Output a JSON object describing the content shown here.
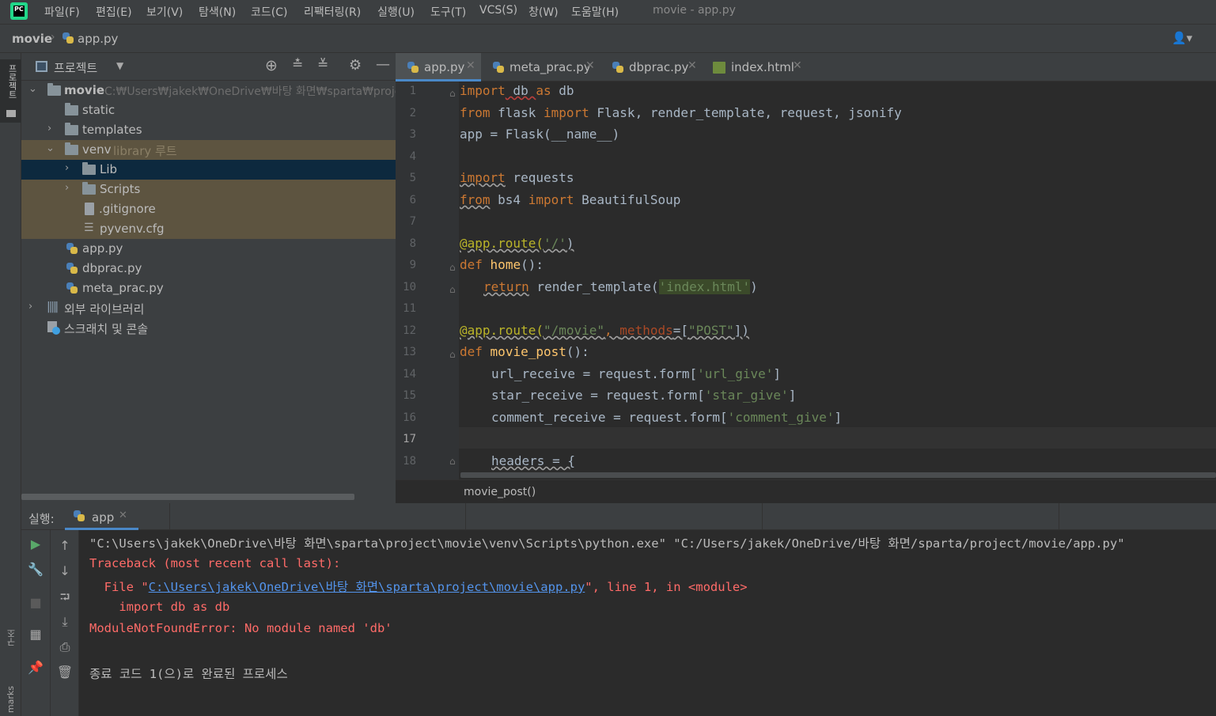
{
  "menubar": {
    "items": [
      "파일(F)",
      "편집(E)",
      "보기(V)",
      "탐색(N)",
      "코드(C)",
      "리팩터링(R)",
      "실행(U)",
      "도구(T)",
      "VCS(S)",
      "창(W)",
      "도움말(H)"
    ],
    "window_title": "movie - app.py"
  },
  "navbar": {
    "project": "movie",
    "file": "app.py"
  },
  "side_stripe": {
    "project_label": "프로젝트",
    "structure_label": "구조",
    "bookmarks_label": "marks"
  },
  "project_panel": {
    "title": "프로젝트",
    "tree": [
      {
        "label": "movie",
        "hint": "C:₩Users₩jakek₩OneDrive₩바탕 화면₩sparta₩project"
      },
      {
        "label": "static"
      },
      {
        "label": "templates"
      },
      {
        "label": "venv",
        "hint": "library 루트"
      },
      {
        "label": "Lib"
      },
      {
        "label": "Scripts"
      },
      {
        "label": ".gitignore"
      },
      {
        "label": "pyvenv.cfg"
      },
      {
        "label": "app.py"
      },
      {
        "label": "dbprac.py"
      },
      {
        "label": "meta_prac.py"
      },
      {
        "label": "외부 라이브러리"
      },
      {
        "label": "스크래치 및 콘솔"
      }
    ]
  },
  "editor": {
    "tabs": [
      "app.py",
      "meta_prac.py",
      "dbprac.py",
      "index.html"
    ],
    "active_tab": "app.py",
    "breadcrumb": "movie_post()",
    "line_numbers": [
      "1",
      "2",
      "3",
      "4",
      "5",
      "6",
      "7",
      "8",
      "9",
      "10",
      "11",
      "12",
      "13",
      "14",
      "15",
      "16",
      "17",
      "18"
    ],
    "code": {
      "l1": [
        "import",
        " db ",
        "as",
        " db"
      ],
      "l2": [
        "from",
        " flask ",
        "import",
        " Flask, render_template, request, jsonify"
      ],
      "l3": "app = Flask(__name__)",
      "l5": [
        "import",
        " requests"
      ],
      "l6": [
        "from",
        " bs4 ",
        "import",
        " BeautifulSoup"
      ],
      "l8": [
        "@app.route(",
        "'/'",
        ")"
      ],
      "l9": [
        "def",
        " ",
        "home",
        "():"
      ],
      "l10": [
        "return",
        " render_template(",
        "'index.html'",
        ")"
      ],
      "l12": [
        "@app.route(",
        "\"/movie\"",
        ", ",
        "methods",
        "=[",
        "\"POST\"",
        "])"
      ],
      "l13": [
        "def",
        " ",
        "movie_post",
        "():"
      ],
      "l14": [
        "url_receive = request.form[",
        "'url_give'",
        "]"
      ],
      "l15": [
        "star_receive = request.form[",
        "'star_give'",
        "]"
      ],
      "l16": [
        "comment_receive = request.form[",
        "'comment_give'",
        "]"
      ],
      "l18": "headers = {"
    }
  },
  "run_panel": {
    "label": "실행:",
    "tab": "app",
    "output": {
      "cmd": "\"C:\\Users\\jakek\\OneDrive\\바탕 화면\\sparta\\project\\movie\\venv\\Scripts\\python.exe\" \"C:/Users/jakek/OneDrive/바탕 화면/sparta/project/movie/app.py\"",
      "traceback": "Traceback (most recent call last):",
      "file_prefix": "  File \"",
      "file_link": "C:\\Users\\jakek\\OneDrive\\바탕 화면\\sparta\\project\\movie\\app.py",
      "file_suffix": "\", line 1, in <module>",
      "import_line": "    import db as db",
      "error": "ModuleNotFoundError: No module named 'db'",
      "exit": "종료 코드 1(으)로 완료된 프로세스"
    }
  },
  "colors": {
    "keyword": "#cc7832",
    "string": "#6a8759",
    "decorator": "#bbb529",
    "function": "#ffc66d",
    "error": "#ff6b68",
    "link": "#5394ec",
    "selection": "#0d293e",
    "excluded_bg": "#5d5440"
  }
}
